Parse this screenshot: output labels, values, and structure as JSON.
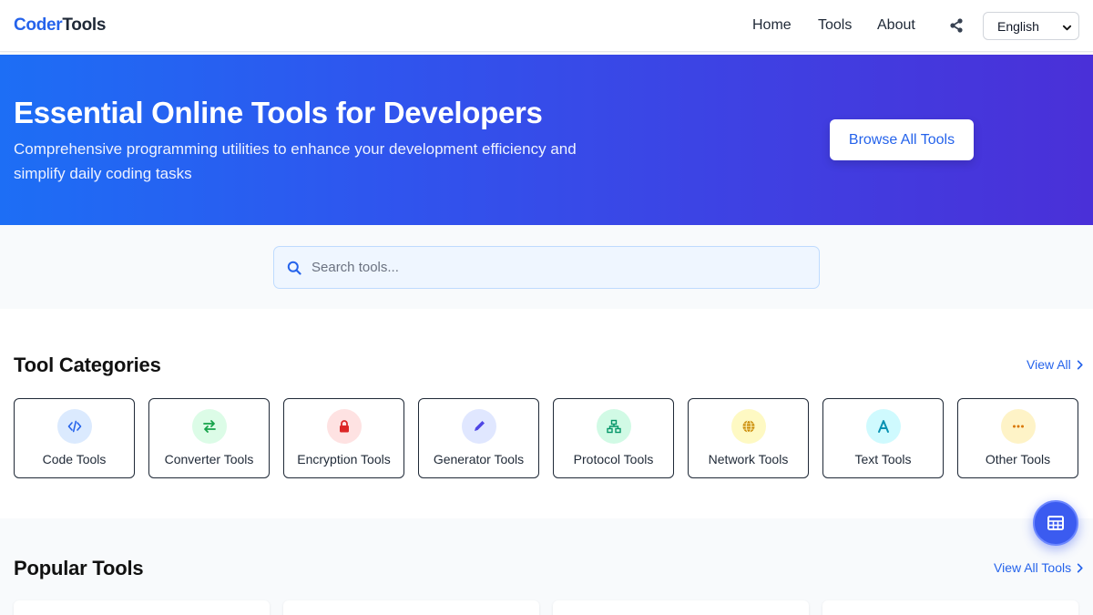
{
  "header": {
    "logo_part1": "Coder",
    "logo_part2": "Tools",
    "nav": [
      "Home",
      "Tools",
      "About"
    ],
    "share_icon": "share-icon",
    "language": "English"
  },
  "hero": {
    "title": "Essential Online Tools for Developers",
    "subtitle": "Comprehensive programming utilities to enhance your development efficiency and simplify daily coding tasks",
    "button": "Browse All Tools"
  },
  "search": {
    "placeholder": "Search tools..."
  },
  "categories": {
    "title": "Tool Categories",
    "view_all": "View All",
    "items": [
      {
        "label": "Code Tools",
        "icon": "code-icon",
        "bg": "#dbeafe",
        "color": "#2563eb"
      },
      {
        "label": "Converter Tools",
        "icon": "arrows-exchange-icon",
        "bg": "#dcfce7",
        "color": "#16a34a"
      },
      {
        "label": "Encryption Tools",
        "icon": "lock-icon",
        "bg": "#fee2e2",
        "color": "#dc2626"
      },
      {
        "label": "Generator Tools",
        "icon": "pencil-icon",
        "bg": "#e0e7ff",
        "color": "#4f46e5"
      },
      {
        "label": "Protocol Tools",
        "icon": "network-tree-icon",
        "bg": "#d1fae5",
        "color": "#059669"
      },
      {
        "label": "Network Tools",
        "icon": "globe-icon",
        "bg": "#fef9c3",
        "color": "#ca8a04"
      },
      {
        "label": "Text Tools",
        "icon": "letter-a-icon",
        "bg": "#cffafe",
        "color": "#0891b2"
      },
      {
        "label": "Other Tools",
        "icon": "ellipsis-icon",
        "bg": "#fef3c7",
        "color": "#d97706"
      }
    ]
  },
  "popular": {
    "title": "Popular Tools",
    "view_all": "View All Tools"
  },
  "fab": {
    "icon": "grid-table-icon"
  }
}
